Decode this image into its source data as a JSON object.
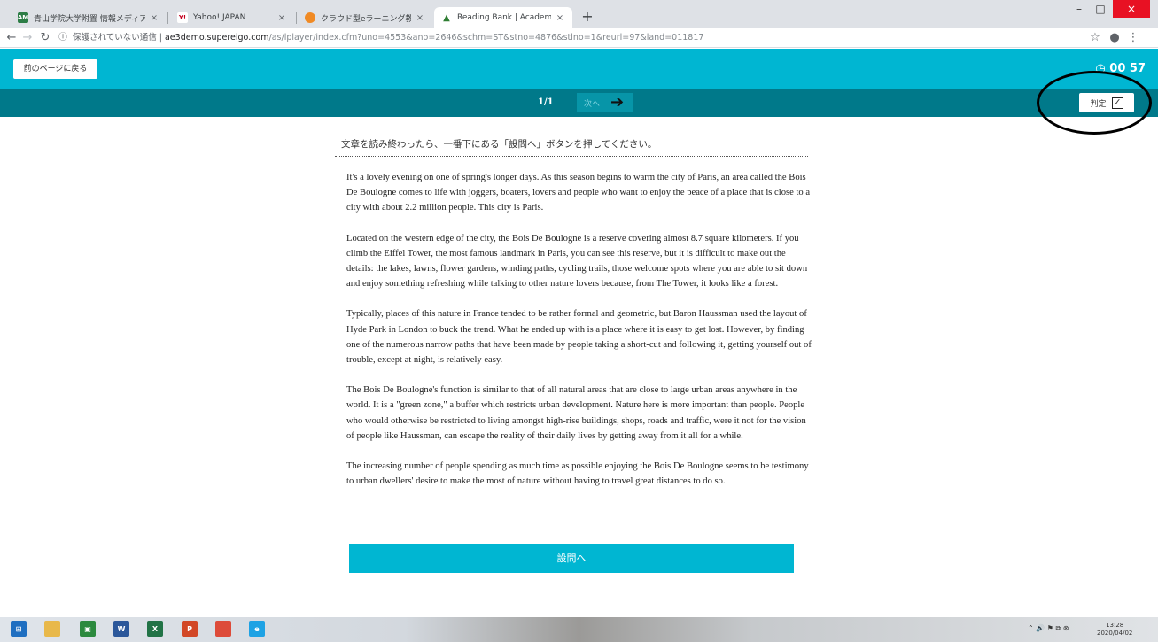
{
  "browser": {
    "tabs": [
      {
        "icon": "aoyama-favicon",
        "title": "青山学院大学附置 情報メディアセ:",
        "close": "×"
      },
      {
        "icon": "yahoo-favicon",
        "title": "Yahoo! JAPAN",
        "close": "×"
      },
      {
        "icon": "cloud-favicon",
        "title": "クラウド型eラーニング教材配信サ-",
        "close": "×"
      },
      {
        "icon": "lock-favicon",
        "title": "Reading Bank | Academic Exp",
        "close": "×"
      }
    ],
    "new_tab": "+",
    "window_controls": {
      "minimize": "–",
      "maximize": "□",
      "close": "×"
    },
    "address": {
      "insecure": "保護されていない通信",
      "domain": "ae3demo.supereigo.com",
      "path": "/as/lplayer/index.cfm?uno=4553&ano=2646&schm=ST&stno=4876&stlno=1&reurl=97&land=011817"
    }
  },
  "app": {
    "back_label": "前のページに戻る",
    "timer": "00 57",
    "page_indicator": "1/1",
    "next_label": "次へ",
    "judge_label": "判定",
    "instruction": "文章を読み終わったら、一番下にある「設問へ」ボタンを押してください。",
    "paragraphs": [
      "It's a lovely evening on one of spring's longer days. As this season begins to warm the city of Paris, an area called the Bois De Boulogne comes to life with joggers, boaters, lovers and people who want to enjoy the peace of a place that is close to a city with about 2.2 million people. This city is Paris.",
      "Located on the western edge of the city, the Bois De Boulogne is a reserve covering almost 8.7 square kilometers. If you climb the Eiffel Tower, the most famous landmark in Paris, you can see this reserve, but it is difficult to make out the details: the lakes, lawns, flower gardens, winding paths, cycling trails, those welcome spots where you are able to sit down and enjoy something refreshing while talking to other nature lovers because, from The Tower, it looks like a forest.",
      "Typically, places of this nature in France tended to be rather formal and geometric, but Baron Haussman used the layout of Hyde Park in London to buck the trend. What he ended up with is a place where it is easy to get lost. However, by finding one of the numerous narrow paths that have been made by people taking a short-cut and following it, getting yourself out of trouble, except at night, is relatively easy.",
      "The Bois De Boulogne's function is similar to that of all natural areas that are close to large urban areas anywhere in the world. It is a \"green zone,\" a buffer which restricts urban development. Nature here is more important than people. People who would otherwise be restricted to living amongst high-rise buildings, shops, roads and traffic, were it not for the vision of people like Haussman, can escape the reality of their daily lives by getting away from it all for a while.",
      "The increasing number of people spending as much time as possible enjoying the Bois De Boulogne seems to be testimony to urban dwellers' desire to make the most of nature without having to travel great distances to do so."
    ],
    "question_button": "設問へ"
  },
  "taskbar": {
    "apps": [
      {
        "name": "windows-start-icon",
        "glyph": "⊞",
        "color": "#1f6fc1"
      },
      {
        "name": "file-explorer-icon",
        "glyph": "",
        "color": "#e8b84a"
      },
      {
        "name": "store-icon",
        "glyph": "▣",
        "color": "#2c8a3e"
      },
      {
        "name": "word-icon",
        "glyph": "W",
        "color": "#2b579a"
      },
      {
        "name": "excel-icon",
        "glyph": "X",
        "color": "#217346"
      },
      {
        "name": "powerpoint-icon",
        "glyph": "P",
        "color": "#d24726"
      },
      {
        "name": "chrome-icon",
        "glyph": "",
        "color": "#dd4b39"
      },
      {
        "name": "ie-icon",
        "glyph": "e",
        "color": "#1ea2e4"
      }
    ],
    "tray": "⌃ 🔊 ⚑ ⧉ ⊗",
    "time": "13:28",
    "date": "2020/04/02"
  },
  "colors": {
    "app_bar": "#00b6d2",
    "sub_bar": "#00798a",
    "question_button": "#00b6d2"
  }
}
